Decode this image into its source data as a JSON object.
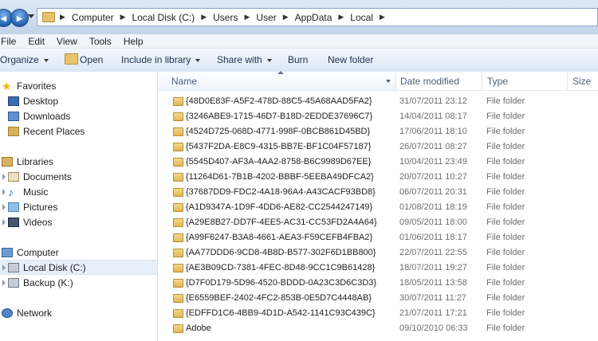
{
  "address": {
    "crumbs": [
      "Computer",
      "Local Disk (C:)",
      "Users",
      "User",
      "AppData",
      "Local"
    ],
    "back_glyph": "◀",
    "forward_glyph": "▶"
  },
  "menu": [
    "File",
    "Edit",
    "View",
    "Tools",
    "Help"
  ],
  "toolbar": {
    "organize": "Organize",
    "open": "Open",
    "include": "Include in library",
    "share": "Share with",
    "burn": "Burn",
    "new_folder": "New folder"
  },
  "nav": {
    "favorites": "Favorites",
    "desktop": "Desktop",
    "downloads": "Downloads",
    "recent": "Recent Places",
    "libraries": "Libraries",
    "documents": "Documents",
    "music": "Music",
    "pictures": "Pictures",
    "videos": "Videos",
    "computer": "Computer",
    "local_disk": "Local Disk (C:)",
    "backup": "Backup (K:)",
    "network": "Network",
    "star_glyph": "★",
    "note_glyph": "♪"
  },
  "columns": {
    "name": "Name",
    "date": "Date modified",
    "type": "Type",
    "size": "Size"
  },
  "files": [
    {
      "name": "{48D0E83F-A5F2-478D-88C5-45A68AAD5FA2}",
      "date": "31/07/2011 23:12",
      "type": "File folder"
    },
    {
      "name": "{3246ABE9-1715-46D7-B18D-2EDDE37696C7}",
      "date": "14/04/2011 08:17",
      "type": "File folder"
    },
    {
      "name": "{4524D725-068D-4771-998F-0BCB861D45BD}",
      "date": "17/06/2011 18:10",
      "type": "File folder"
    },
    {
      "name": "{5437F2DA-E8C9-4315-BB7E-BF1C04F57187}",
      "date": "26/07/2011 08:27",
      "type": "File folder"
    },
    {
      "name": "{5545D407-AF3A-4AA2-8758-B6C9989D67EE}",
      "date": "10/04/2011 23:49",
      "type": "File folder"
    },
    {
      "name": "{11264D61-7B1B-4202-BBBF-5EEBA49DFCA2}",
      "date": "20/07/2011 10:27",
      "type": "File folder"
    },
    {
      "name": "{37687DD9-FDC2-4A18-96A4-A43CACF93BD8}",
      "date": "06/07/2011 20:31",
      "type": "File folder"
    },
    {
      "name": "{A1D9347A-1D9F-4DD6-AE82-CC2544247149}",
      "date": "01/08/2011 18:19",
      "type": "File folder"
    },
    {
      "name": "{A29E8B27-DD7F-4EE5-AC31-CC53FD2A4A64}",
      "date": "09/05/2011 18:00",
      "type": "File folder"
    },
    {
      "name": "{A99F6247-B3A8-4661-AEA3-F59CEFB4FBA2}",
      "date": "01/06/2011 18:17",
      "type": "File folder"
    },
    {
      "name": "{AA77DDD6-9CD8-4B8D-B577-302F6D1BB800}",
      "date": "22/07/2011 22:55",
      "type": "File folder"
    },
    {
      "name": "{AE3B09CD-7381-4FEC-8D48-9CC1C9B61428}",
      "date": "18/07/2011 19:27",
      "type": "File folder"
    },
    {
      "name": "{D7F0D179-5D96-4520-BDDD-0A23C3D6C3D3}",
      "date": "18/05/2011 13:58",
      "type": "File folder"
    },
    {
      "name": "{E6559BEF-2402-4FC2-853B-0E5D7C4448AB}",
      "date": "30/07/2011 11:27",
      "type": "File folder"
    },
    {
      "name": "{EDFFD1C6-4BB9-4D1D-A542-1141C93C439C}",
      "date": "21/07/2011 17:21",
      "type": "File folder"
    },
    {
      "name": "Adobe",
      "date": "09/10/2010 06:33",
      "type": "File folder"
    }
  ]
}
